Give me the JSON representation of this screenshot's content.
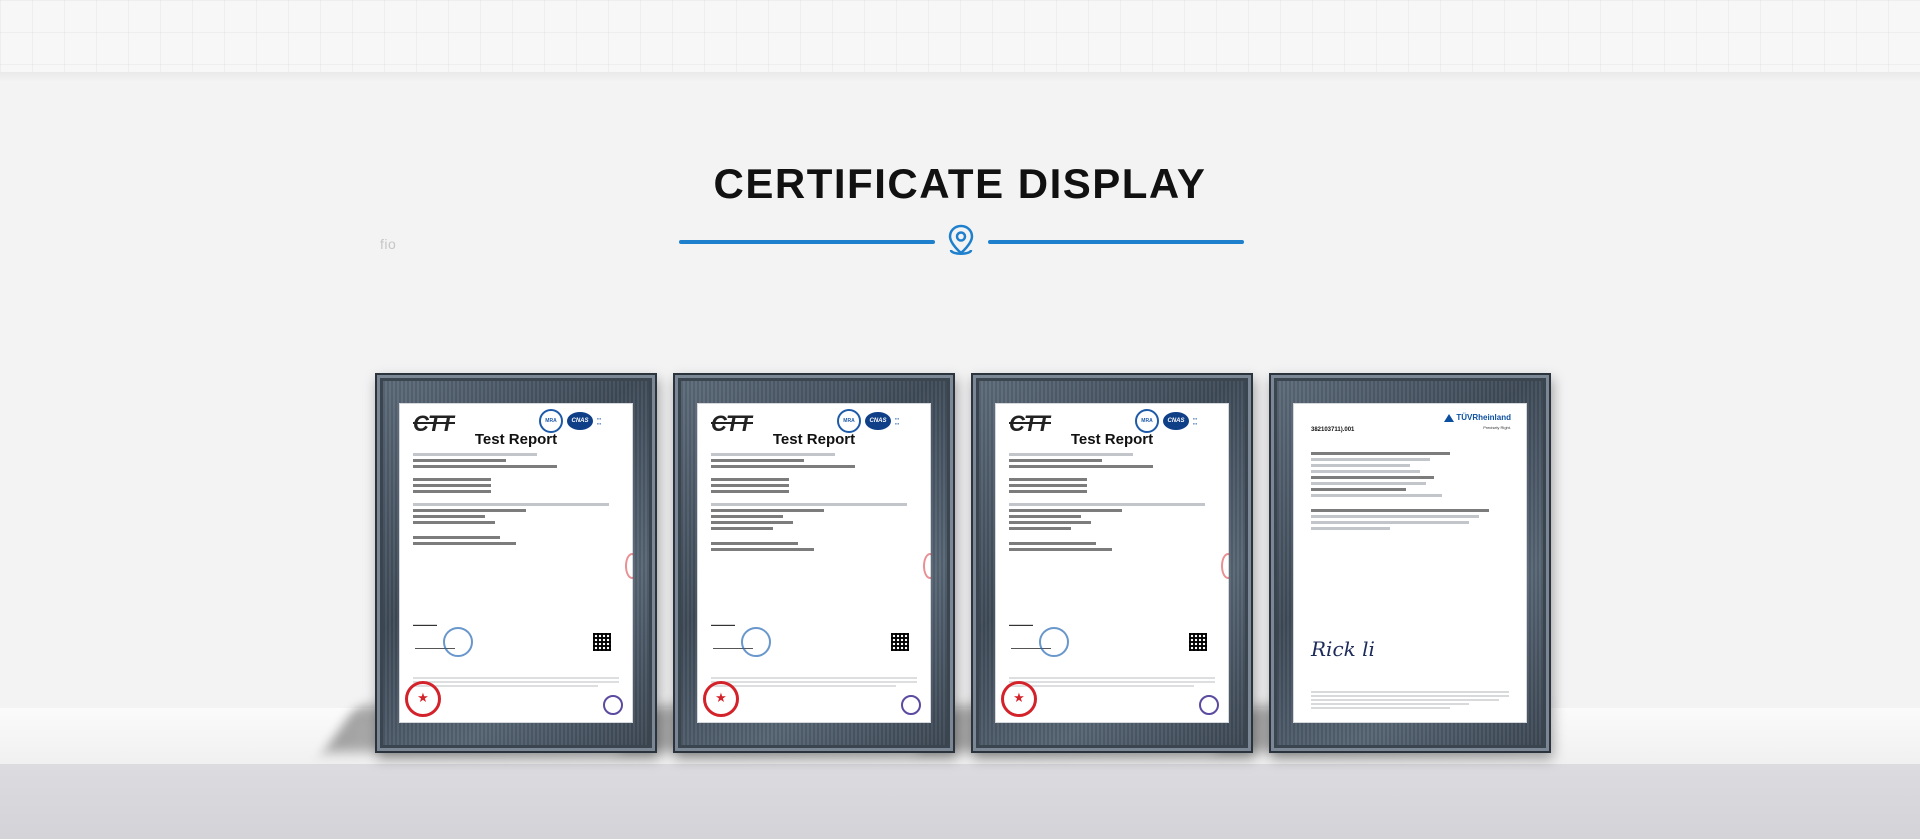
{
  "section": {
    "title": "CERTIFICATE DISPLAY",
    "ghost_text": "fio",
    "divider_icon": "map-pin-icon",
    "accent_color": "#1e80cc"
  },
  "certificates": [
    {
      "type": "CTT",
      "logo": "CTT",
      "heading": "Test Report"
    },
    {
      "type": "CTT",
      "logo": "CTT",
      "heading": "Test Report"
    },
    {
      "type": "CTT",
      "logo": "CTT",
      "heading": "Test Report"
    },
    {
      "type": "TUV",
      "logo": "TÜVRheinland",
      "subtitle": "Precisely Right.",
      "report_no": "382103711).001"
    }
  ]
}
